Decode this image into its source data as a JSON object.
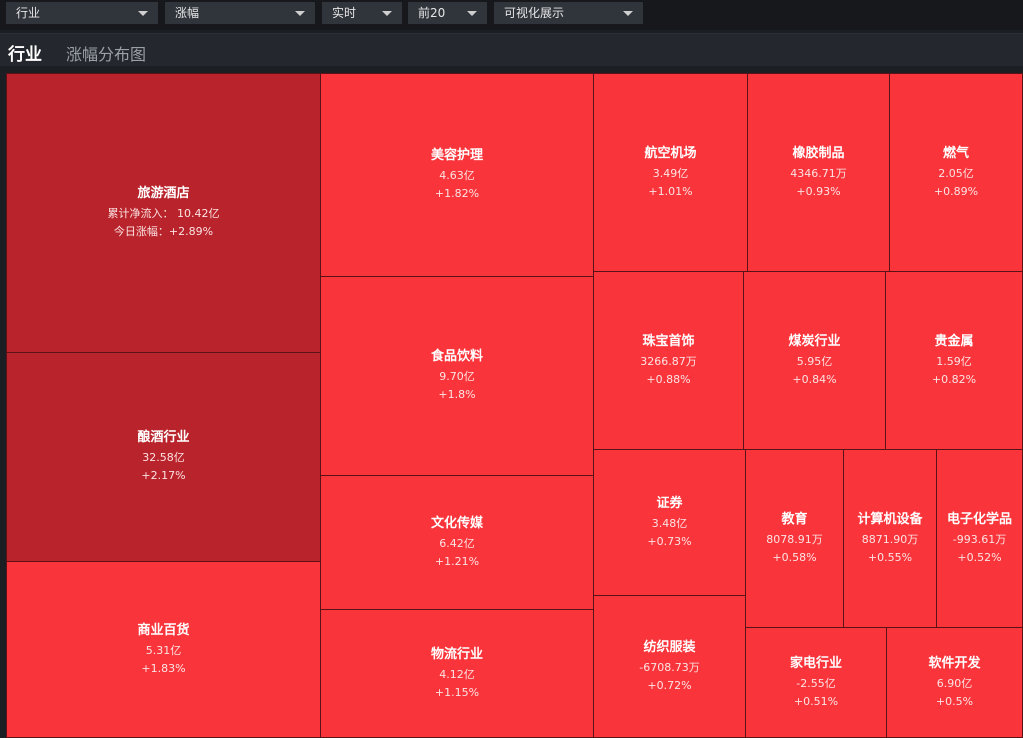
{
  "toolbar": {
    "dropdowns": [
      {
        "selected": "行业"
      },
      {
        "selected": "涨幅"
      },
      {
        "selected": "实时"
      },
      {
        "selected": "前20"
      },
      {
        "selected": "可视化展示"
      }
    ]
  },
  "header": {
    "title": "行业",
    "subtitle": "涨幅分布图"
  },
  "colors": {
    "strong_red": "#b9232b",
    "red": "#f9353b",
    "border": "#5a1216",
    "background": "#1b1e23"
  },
  "tooltip_labels": {
    "net_inflow_prefix": "累计净流入：",
    "change_prefix": "今日涨幅："
  },
  "chart_data": {
    "type": "treemap",
    "items": [
      {
        "name": "旅游酒店",
        "net_inflow": "10.42亿",
        "change": "+2.89%"
      },
      {
        "name": "酿酒行业",
        "net_inflow": "32.58亿",
        "change": "+2.17%"
      },
      {
        "name": "商业百货",
        "net_inflow": "5.31亿",
        "change": "+1.83%"
      },
      {
        "name": "美容护理",
        "net_inflow": "4.63亿",
        "change": "+1.82%"
      },
      {
        "name": "食品饮料",
        "net_inflow": "9.70亿",
        "change": "+1.8%"
      },
      {
        "name": "文化传媒",
        "net_inflow": "6.42亿",
        "change": "+1.21%"
      },
      {
        "name": "物流行业",
        "net_inflow": "4.12亿",
        "change": "+1.15%"
      },
      {
        "name": "航空机场",
        "net_inflow": "3.49亿",
        "change": "+1.01%"
      },
      {
        "name": "橡胶制品",
        "net_inflow": "4346.71万",
        "change": "+0.93%"
      },
      {
        "name": "燃气",
        "net_inflow": "2.05亿",
        "change": "+0.89%"
      },
      {
        "name": "珠宝首饰",
        "net_inflow": "3266.87万",
        "change": "+0.88%"
      },
      {
        "name": "煤炭行业",
        "net_inflow": "5.95亿",
        "change": "+0.84%"
      },
      {
        "name": "贵金属",
        "net_inflow": "1.59亿",
        "change": "+0.82%"
      },
      {
        "name": "证券",
        "net_inflow": "3.48亿",
        "change": "+0.73%"
      },
      {
        "name": "教育",
        "net_inflow": "8078.91万",
        "change": "+0.58%"
      },
      {
        "name": "计算机设备",
        "net_inflow": "8871.90万",
        "change": "+0.55%"
      },
      {
        "name": "电子化学品",
        "net_inflow": "-993.61万",
        "change": "+0.52%"
      },
      {
        "name": "纺织服装",
        "net_inflow": "-6708.73万",
        "change": "+0.72%"
      },
      {
        "name": "家电行业",
        "net_inflow": "-2.55亿",
        "change": "+0.51%"
      },
      {
        "name": "软件开发",
        "net_inflow": "6.90亿",
        "change": "+0.5%"
      }
    ]
  }
}
